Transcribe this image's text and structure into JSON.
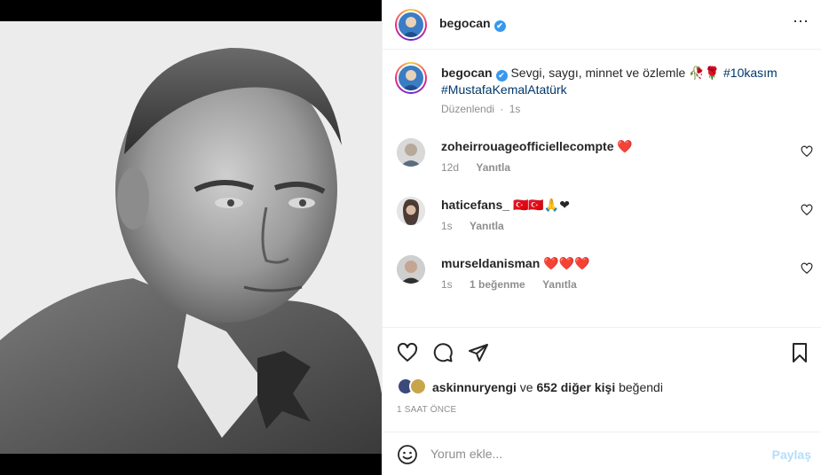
{
  "post": {
    "author": "begocan",
    "verified_mark": "✔",
    "more_icon": "⋯",
    "caption_text": "Sevgi, saygı, minnet ve özlemle ",
    "caption_emoji": "🥀🌹",
    "hashtag_1": "#10kasım",
    "hashtag_2": "#MustafaKemalAtatürk",
    "edited_label": "Düzenlendi",
    "edited_time": "1s"
  },
  "comments": [
    {
      "user": "zoheirrouageofficiellecompte",
      "text": "❤️",
      "time": "12d",
      "likes": "",
      "reply": "Yanıtla"
    },
    {
      "user": "haticefans_",
      "text": "🇹🇷🇹🇷🙏❤",
      "time": "1s",
      "likes": "",
      "reply": "Yanıtla"
    },
    {
      "user": "murseldanisman",
      "text": "❤️❤️❤️",
      "time": "1s",
      "likes": "1 beğenme",
      "reply": "Yanıtla"
    }
  ],
  "likes": {
    "user": "askinnuryengi",
    "connector": " ve ",
    "count_text": "652 diğer kişi",
    "suffix": " beğendi"
  },
  "timestamp": "1 SAAT ÖNCE",
  "compose": {
    "placeholder": "Yorum ekle...",
    "share_label": "Paylaş"
  },
  "icons": {
    "like": "heart-icon",
    "comment": "comment-icon",
    "share": "paper-plane-icon",
    "save": "bookmark-icon",
    "emoji": "smiley-icon"
  },
  "colors": {
    "verified": "#3897f0",
    "hashtag": "#00376b",
    "share_disabled": "#b2dffc",
    "muted": "#8e8e8e"
  }
}
